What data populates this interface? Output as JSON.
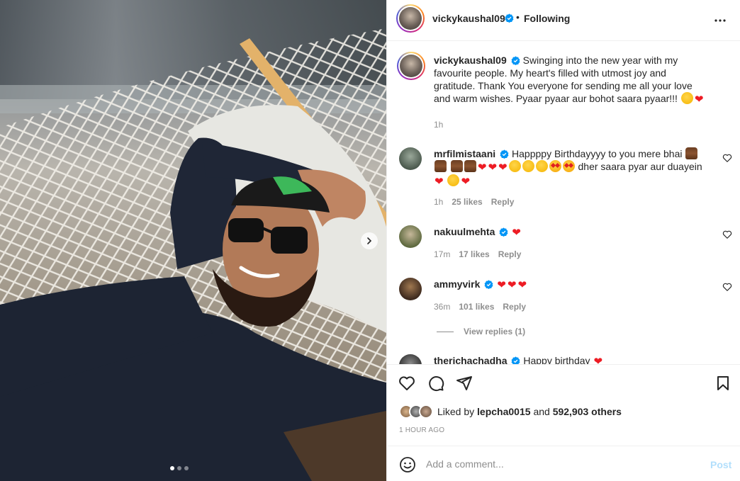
{
  "post": {
    "username": "vickykaushal09",
    "follow_state": "Following",
    "separator": "•",
    "caption": "Swinging into the new year with my favourite people. My heart's filled with utmost joy and gratitude. Thank You everyone for sending me all your love and warm wishes. Pyaar pyaar aur bohot saara pyaar!!!",
    "caption_time": "1h"
  },
  "comments": [
    {
      "username": "mrfilmistaani",
      "text_start": "Happppy Birthdayyyy to you mere bhai",
      "text_mid": "dher saara pyar aur duayein",
      "time": "1h",
      "likes": "25 likes",
      "reply": "Reply"
    },
    {
      "username": "nakuulmehta",
      "time": "17m",
      "likes": "17 likes",
      "reply": "Reply"
    },
    {
      "username": "ammyvirk",
      "time": "36m",
      "likes": "101 likes",
      "reply": "Reply",
      "view_replies": "View replies (1)"
    },
    {
      "username": "therichachadha",
      "text_start": "Happy birthday"
    }
  ],
  "actions": {
    "liked_by_prefix": "Liked by",
    "liked_by_user": "lepcha0015",
    "liked_by_and": "and",
    "liked_by_others": "592,903 others",
    "time_ago": "1 hour ago"
  },
  "add_comment": {
    "placeholder": "Add a comment...",
    "post_label": "Post"
  },
  "colors": {
    "verified": "#0095f6",
    "heart": "#ed1c24",
    "post_disabled": "#b2dffc",
    "muted": "#8e8e8e"
  },
  "icons": [
    "like-icon",
    "comment-icon",
    "share-icon",
    "save-icon",
    "emoji-icon",
    "more-icon",
    "verified-icon",
    "next-arrow-icon"
  ]
}
